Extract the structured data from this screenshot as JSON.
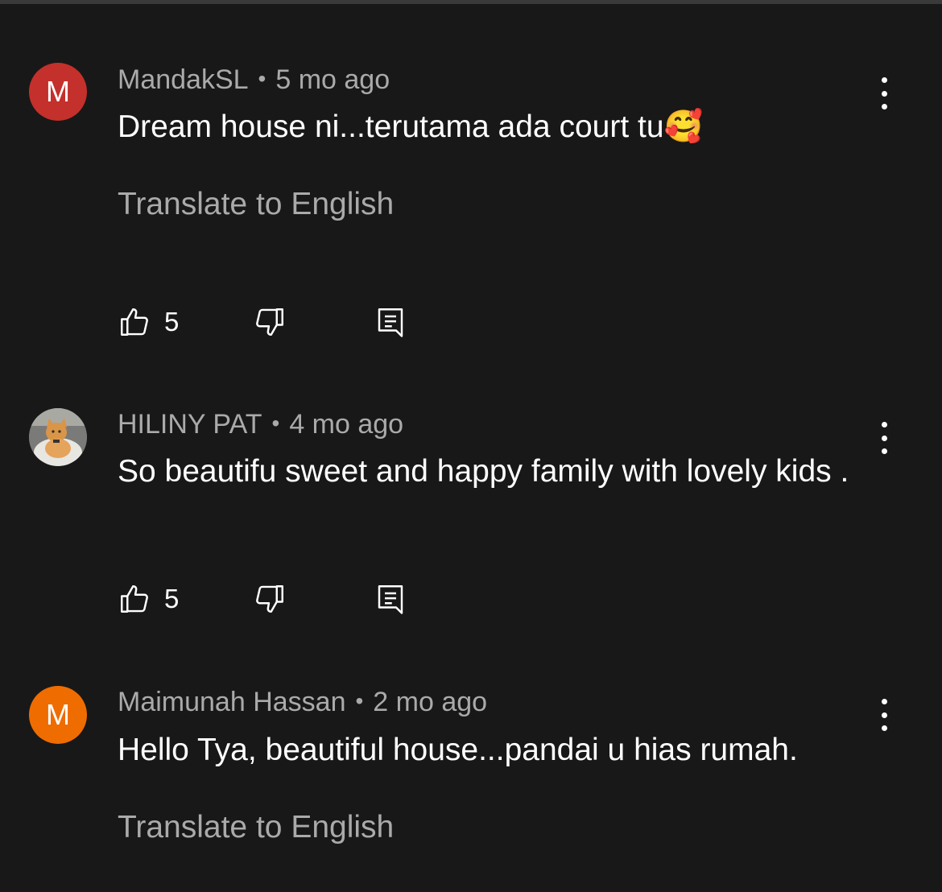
{
  "comments": [
    {
      "author": "MandakSL",
      "time": "5 mo ago",
      "avatar_letter": "M",
      "avatar_color": "#c4302b",
      "text": "Dream house ni...terutama ada court tu🥰",
      "translate_label": "Translate to English",
      "likes": "5"
    },
    {
      "author": "HILINY PAT",
      "time": "4 mo ago",
      "avatar_letter": "",
      "text": "So beautifu sweet and happy family with lovely kids .",
      "likes": "5"
    },
    {
      "author": "Maimunah Hassan",
      "time": "2 mo ago",
      "avatar_letter": "M",
      "avatar_color": "#ef6c00",
      "text": "Hello Tya, beautiful house...pandai u hias rumah.",
      "translate_label": "Translate to English"
    }
  ],
  "separator": "•"
}
